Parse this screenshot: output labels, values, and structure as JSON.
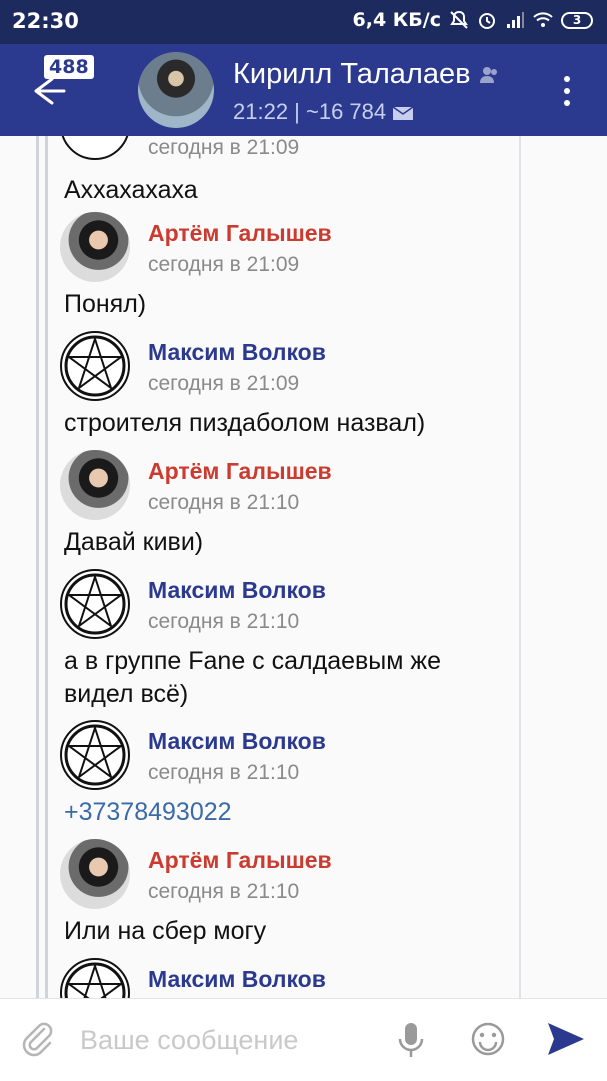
{
  "status_bar": {
    "time": "22:30",
    "speed": "6,4 КБ/с",
    "battery": "3"
  },
  "toolbar": {
    "unread_count": "488",
    "title": "Кирилл Талалаев",
    "subtitle": "21:22 | ~16 784",
    "icons": [
      "back-arrow-icon",
      "group-icon",
      "mail-icon",
      "more-vert-icon"
    ]
  },
  "messages": [
    {
      "sender": "",
      "time": "сегодня в 21:09",
      "text": "Аххахахаха",
      "avatar": "partial"
    },
    {
      "sender": "Артём Галышев",
      "time": "сегодня в 21:09",
      "text": "Понял)",
      "avatar": "artem"
    },
    {
      "sender": "Максим Волков",
      "time": "сегодня в 21:09",
      "text": "строителя пиздаболом назвал)",
      "avatar": "maksim"
    },
    {
      "sender": "Артём Галышев",
      "time": "сегодня в 21:10",
      "text": "Давай киви)",
      "avatar": "artem"
    },
    {
      "sender": "Максим Волков",
      "time": "сегодня в 21:10",
      "text_lines": [
        "а в группе Fane с салдаевым же",
        "видел всё)"
      ],
      "avatar": "maksim"
    },
    {
      "sender": "Максим Волков",
      "time": "сегодня в 21:10",
      "text": "+37378493022",
      "avatar": "maksim",
      "is_link": true
    },
    {
      "sender": "Артём Галышев",
      "time": "сегодня в 21:10",
      "text": "Или на сбер могу",
      "avatar": "artem"
    },
    {
      "sender": "Максим Волков",
      "time": "",
      "text": "",
      "avatar": "maksim"
    }
  ],
  "input": {
    "placeholder": "Ваше сообщение",
    "value": ""
  },
  "colors": {
    "status_bar": "#1c2a5e",
    "toolbar": "#2b3a8f",
    "sender_red": "#cc3b2f",
    "sender_blue": "#2b3a8f",
    "link": "#3a6aa8"
  }
}
